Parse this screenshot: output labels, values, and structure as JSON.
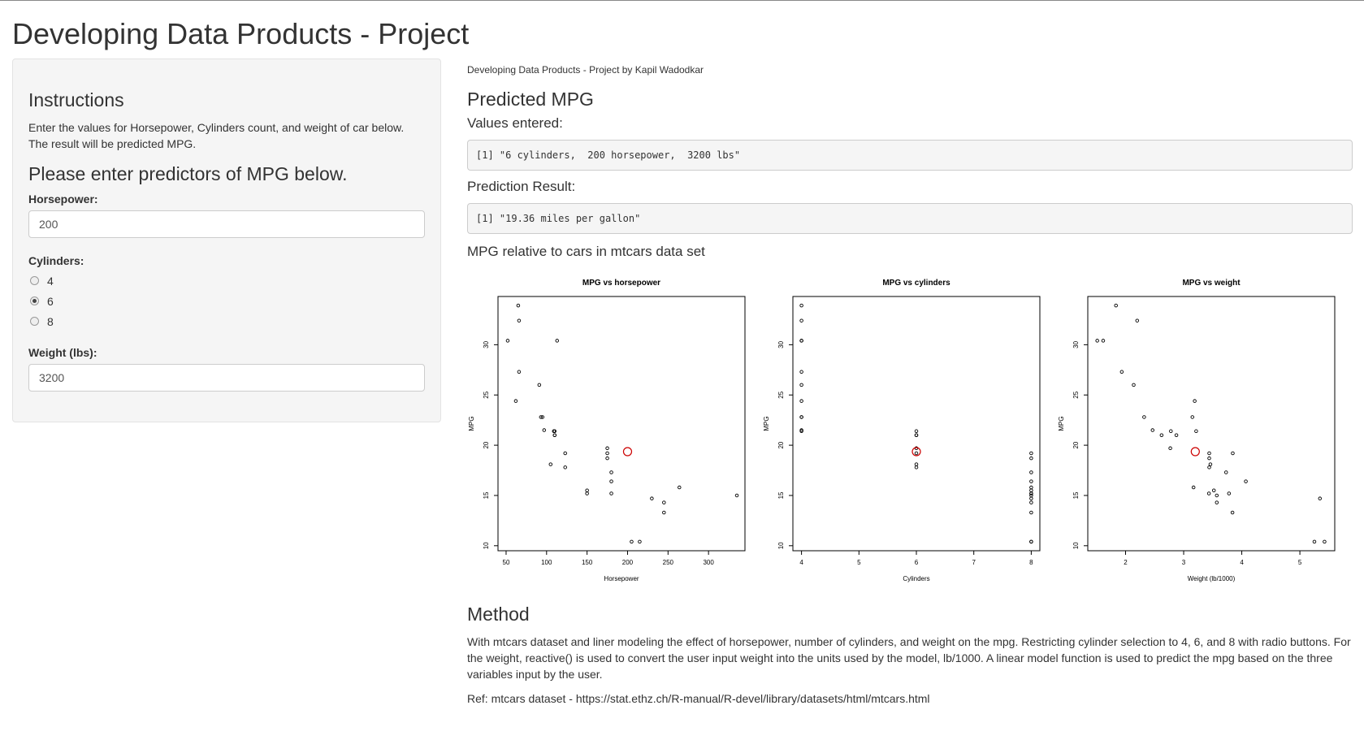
{
  "page": {
    "title": "Developing Data Products - Project"
  },
  "sidebar": {
    "instructions_heading": "Instructions",
    "instructions_line1": "Enter the values for Horsepower, Cylinders count, and weight of car below.",
    "instructions_line2": "The result will be predicted MPG.",
    "predictors_heading": "Please enter predictors of MPG below.",
    "horsepower_label": "Horsepower:",
    "horsepower_value": "200",
    "cylinders_label": "Cylinders:",
    "cylinder_options": [
      "4",
      "6",
      "8"
    ],
    "cylinder_selected": "6",
    "weight_label": "Weight (lbs):",
    "weight_value": "3200"
  },
  "main": {
    "byline": "Developing Data Products - Project by Kapil Wadodkar",
    "predicted_heading": "Predicted MPG",
    "values_entered_label": "Values entered:",
    "values_entered_output": "[1] \"6 cylinders,  200 horsepower,  3200 lbs\"",
    "prediction_label": "Prediction Result:",
    "prediction_output": "[1] \"19.36 miles per gallon\"",
    "plots_heading": "MPG relative to cars in mtcars data set",
    "method_heading": "Method",
    "method_paragraph": "With mtcars dataset and liner modeling the effect of horsepower, number of cylinders, and weight on the mpg. Restricting cylinder selection to 4, 6, and 8 with radio buttons. For the weight, reactive() is used to convert the user input weight into the units used by the model, lb/1000. A linear model function is used to predict the mpg based on the three variables input by the user.",
    "ref_text": "Ref: mtcars dataset - https://stat.ethz.ch/R-manual/R-devel/library/datasets/html/mtcars.html"
  },
  "colors": {
    "highlight_point": "#cc0000",
    "points": "#000000"
  },
  "chart_data": [
    {
      "type": "scatter",
      "title": "MPG vs horsepower",
      "xlabel": "Horsepower",
      "ylabel": "MPG",
      "xlim": [
        40,
        345
      ],
      "ylim": [
        9.5,
        34.8
      ],
      "xticks": [
        50,
        100,
        150,
        200,
        250,
        300
      ],
      "yticks": [
        10,
        15,
        20,
        25,
        30
      ],
      "points": [
        [
          110,
          21.0
        ],
        [
          110,
          21.0
        ],
        [
          93,
          22.8
        ],
        [
          110,
          21.4
        ],
        [
          175,
          18.7
        ],
        [
          105,
          18.1
        ],
        [
          245,
          14.3
        ],
        [
          62,
          24.4
        ],
        [
          95,
          22.8
        ],
        [
          123,
          19.2
        ],
        [
          123,
          17.8
        ],
        [
          180,
          16.4
        ],
        [
          180,
          17.3
        ],
        [
          180,
          15.2
        ],
        [
          205,
          10.4
        ],
        [
          215,
          10.4
        ],
        [
          230,
          14.7
        ],
        [
          66,
          32.4
        ],
        [
          52,
          30.4
        ],
        [
          65,
          33.9
        ],
        [
          97,
          21.5
        ],
        [
          150,
          15.5
        ],
        [
          150,
          15.2
        ],
        [
          245,
          13.3
        ],
        [
          175,
          19.2
        ],
        [
          66,
          27.3
        ],
        [
          91,
          26.0
        ],
        [
          113,
          30.4
        ],
        [
          264,
          15.8
        ],
        [
          175,
          19.7
        ],
        [
          335,
          15.0
        ],
        [
          109,
          21.4
        ]
      ],
      "highlight": [
        200,
        19.36
      ]
    },
    {
      "type": "scatter",
      "title": "MPG vs cylinders",
      "xlabel": "Cylinders",
      "ylabel": "MPG",
      "xlim": [
        3.85,
        8.15
      ],
      "ylim": [
        9.5,
        34.8
      ],
      "xticks": [
        4,
        5,
        6,
        7,
        8
      ],
      "yticks": [
        10,
        15,
        20,
        25,
        30
      ],
      "points": [
        [
          6,
          21.0
        ],
        [
          6,
          21.0
        ],
        [
          4,
          22.8
        ],
        [
          6,
          21.4
        ],
        [
          8,
          18.7
        ],
        [
          6,
          18.1
        ],
        [
          8,
          14.3
        ],
        [
          4,
          24.4
        ],
        [
          4,
          22.8
        ],
        [
          6,
          19.2
        ],
        [
          6,
          17.8
        ],
        [
          8,
          16.4
        ],
        [
          8,
          17.3
        ],
        [
          8,
          15.2
        ],
        [
          8,
          10.4
        ],
        [
          8,
          10.4
        ],
        [
          8,
          14.7
        ],
        [
          4,
          32.4
        ],
        [
          4,
          30.4
        ],
        [
          4,
          33.9
        ],
        [
          4,
          21.5
        ],
        [
          8,
          15.5
        ],
        [
          8,
          15.2
        ],
        [
          8,
          13.3
        ],
        [
          8,
          19.2
        ],
        [
          4,
          27.3
        ],
        [
          4,
          26.0
        ],
        [
          4,
          30.4
        ],
        [
          8,
          15.8
        ],
        [
          6,
          19.7
        ],
        [
          8,
          15.0
        ],
        [
          4,
          21.4
        ]
      ],
      "highlight": [
        6,
        19.36
      ]
    },
    {
      "type": "scatter",
      "title": "MPG vs weight",
      "xlabel": "Weight (lb/1000)",
      "ylabel": "MPG",
      "xlim": [
        1.35,
        5.6
      ],
      "ylim": [
        9.5,
        34.8
      ],
      "xticks": [
        2,
        3,
        4,
        5
      ],
      "yticks": [
        10,
        15,
        20,
        25,
        30
      ],
      "points": [
        [
          2.62,
          21.0
        ],
        [
          2.875,
          21.0
        ],
        [
          2.32,
          22.8
        ],
        [
          3.215,
          21.4
        ],
        [
          3.44,
          18.7
        ],
        [
          3.46,
          18.1
        ],
        [
          3.57,
          14.3
        ],
        [
          3.19,
          24.4
        ],
        [
          3.15,
          22.8
        ],
        [
          3.44,
          19.2
        ],
        [
          3.44,
          17.8
        ],
        [
          4.07,
          16.4
        ],
        [
          3.73,
          17.3
        ],
        [
          3.78,
          15.2
        ],
        [
          5.25,
          10.4
        ],
        [
          5.424,
          10.4
        ],
        [
          5.345,
          14.7
        ],
        [
          2.2,
          32.4
        ],
        [
          1.615,
          30.4
        ],
        [
          1.835,
          33.9
        ],
        [
          2.465,
          21.5
        ],
        [
          3.52,
          15.5
        ],
        [
          3.435,
          15.2
        ],
        [
          3.84,
          13.3
        ],
        [
          3.845,
          19.2
        ],
        [
          1.935,
          27.3
        ],
        [
          2.14,
          26.0
        ],
        [
          1.513,
          30.4
        ],
        [
          3.17,
          15.8
        ],
        [
          2.77,
          19.7
        ],
        [
          3.57,
          15.0
        ],
        [
          2.78,
          21.4
        ]
      ],
      "highlight": [
        3.2,
        19.36
      ]
    }
  ]
}
